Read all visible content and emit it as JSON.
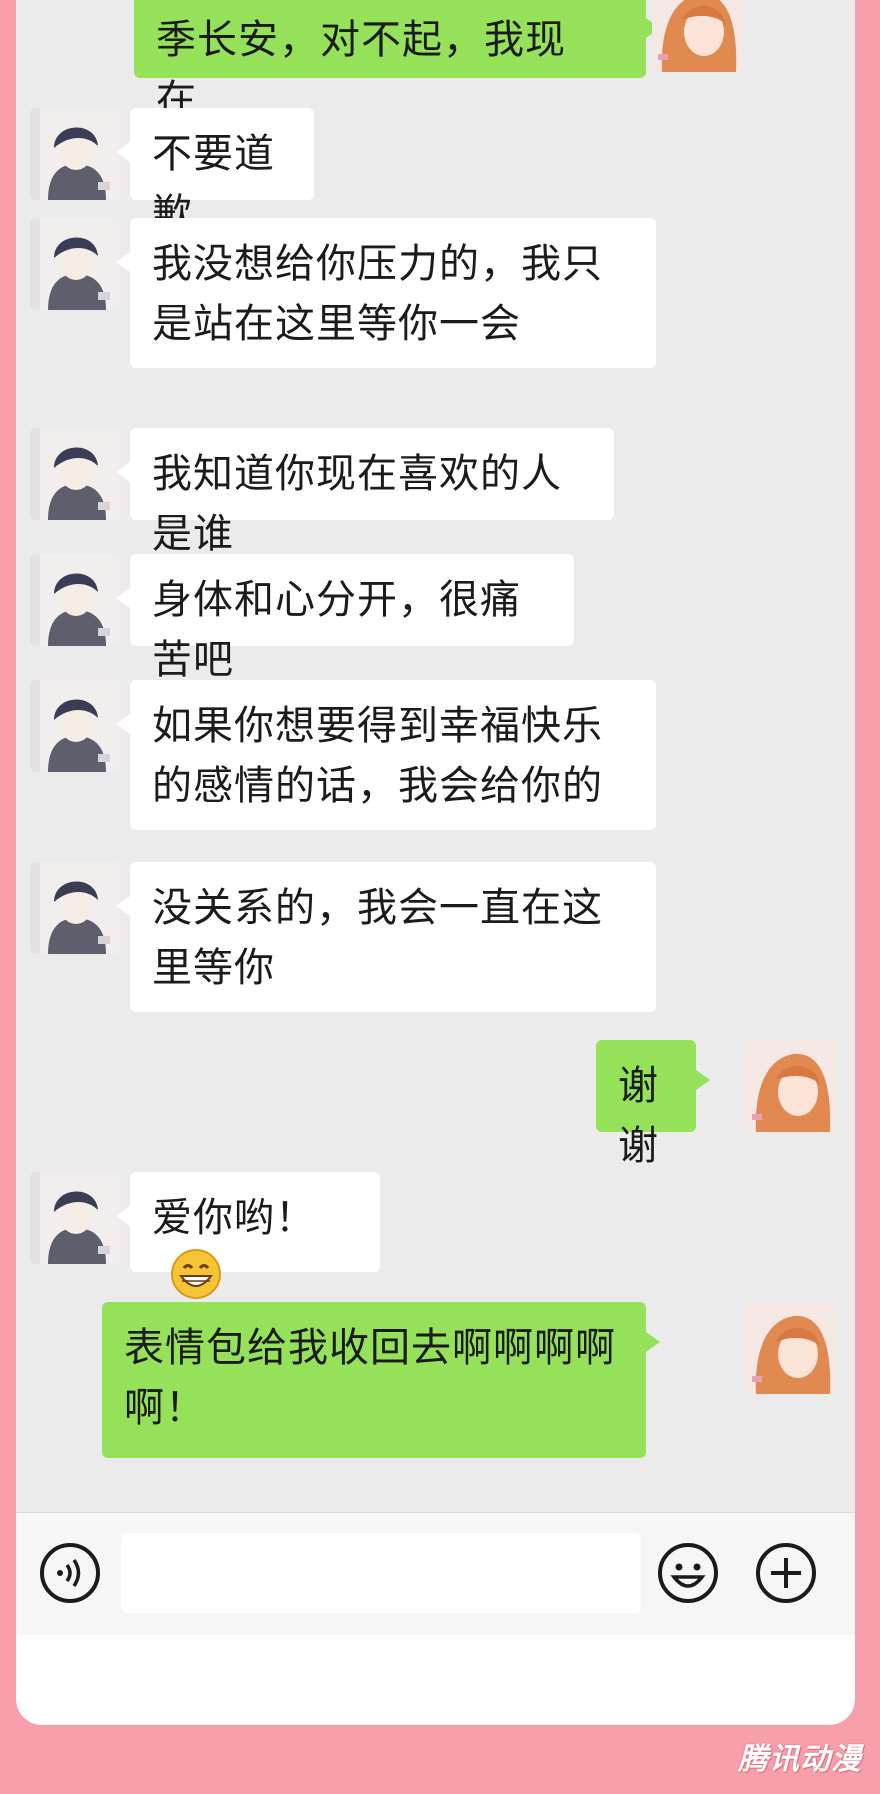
{
  "messages": [
    {
      "side": "out",
      "text": "季长安，对不起，我现在……"
    },
    {
      "side": "in",
      "text": "不要道歉"
    },
    {
      "side": "in",
      "text": "我没想给你压力的，我只是站在这里等你一会"
    },
    {
      "side": "in",
      "text": "我知道你现在喜欢的人是谁"
    },
    {
      "side": "in",
      "text": "身体和心分开，很痛苦吧"
    },
    {
      "side": "in",
      "text": "如果你想要得到幸福快乐的感情的话，我会给你的"
    },
    {
      "side": "in",
      "text": "没关系的，我会一直在这里等你"
    },
    {
      "side": "out",
      "text": "谢谢"
    },
    {
      "side": "in",
      "text": "爱你哟！",
      "emoji": "grinning-face-icon"
    },
    {
      "side": "out",
      "text": "表情包给我收回去啊啊啊啊啊！"
    }
  ],
  "input_bar": {
    "voice_icon": "voice-icon",
    "text_value": "",
    "emoji_icon": "smiley-icon",
    "plus_icon": "plus-icon"
  },
  "watermark": "腾讯动漫",
  "colors": {
    "frame": "#f7a0ab",
    "chat_bg": "#ebebeb",
    "out_bubble": "#95e15a",
    "in_bubble": "#ffffff"
  }
}
